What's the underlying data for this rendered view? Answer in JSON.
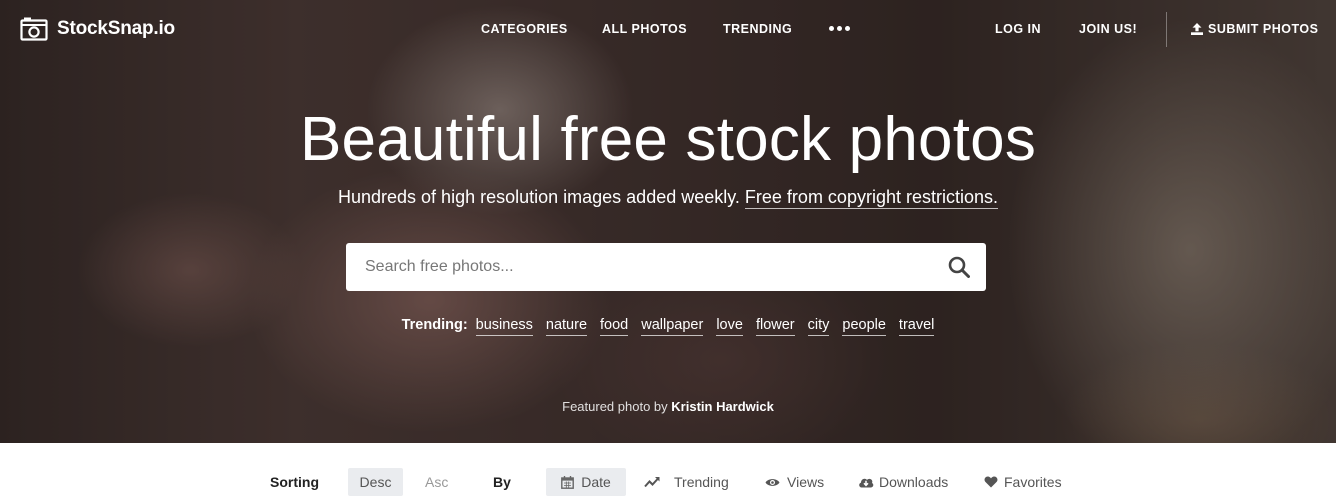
{
  "nav": {
    "logo_text": "StockSnap.io",
    "logo_icon": "camera-icon",
    "links": {
      "categories": "CATEGORIES",
      "all_photos": "ALL PHOTOS",
      "trending": "TRENDING",
      "more_icon": "more-dots-icon",
      "login": "LOG IN",
      "join": "JOIN US!",
      "submit": "SUBMIT PHOTOS",
      "submit_icon": "upload-icon"
    }
  },
  "hero": {
    "headline": "Beautiful free stock photos",
    "subline_text": "Hundreds of high resolution images added weekly.",
    "subline_link": "Free from copyright restrictions.",
    "search": {
      "placeholder": "Search free photos...",
      "value": "",
      "icon": "search-icon"
    },
    "trending": {
      "label": "Trending:",
      "tags": [
        "business",
        "nature",
        "food",
        "wallpaper",
        "love",
        "flower",
        "city",
        "people",
        "travel"
      ]
    },
    "credit": {
      "prefix": "Featured photo by",
      "name": "Kristin Hardwick"
    }
  },
  "sortbar": {
    "sorting_label": "Sorting",
    "desc": "Desc",
    "asc": "Asc",
    "active_order": "Desc",
    "by_label": "By",
    "options": {
      "date": "Date",
      "trending": "Trending",
      "views": "Views",
      "downloads": "Downloads",
      "favorites": "Favorites"
    },
    "active_option": "Date"
  },
  "colors": {
    "nav_text": "#ffffff",
    "active_pill": "#eaecef",
    "muted_text": "#999999"
  }
}
